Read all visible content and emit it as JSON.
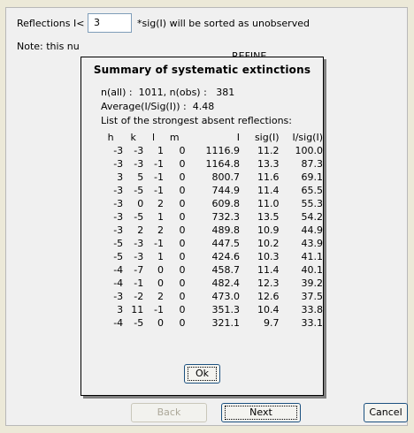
{
  "form": {
    "reflections_label": "Reflections I<",
    "reflections_value": "3",
    "reflections_suffix": "*sig(I) will be sorted as unobserved",
    "note_text": "Note: this nu",
    "note_fragment": "REFINE"
  },
  "summary": {
    "title": "Summary of systematic extinctions",
    "line_counts": "n(all) :  1011, n(obs) :   381",
    "line_average": "Average(I/Sig(I)) :  4.48",
    "line_list": "List of the strongest absent reflections:",
    "columns": [
      "h",
      "k",
      "l",
      "m",
      "I",
      "sig(I)",
      "I/sig(I)"
    ],
    "rows": [
      [
        "-3",
        "-3",
        "1",
        "0",
        "1116.9",
        "11.2",
        "100.0"
      ],
      [
        "-3",
        "-3",
        "-1",
        "0",
        "1164.8",
        "13.3",
        "87.3"
      ],
      [
        "3",
        "5",
        "-1",
        "0",
        "800.7",
        "11.6",
        "69.1"
      ],
      [
        "-3",
        "-5",
        "-1",
        "0",
        "744.9",
        "11.4",
        "65.5"
      ],
      [
        "-3",
        "0",
        "2",
        "0",
        "609.8",
        "11.0",
        "55.3"
      ],
      [
        "-3",
        "-5",
        "1",
        "0",
        "732.3",
        "13.5",
        "54.2"
      ],
      [
        "-3",
        "2",
        "2",
        "0",
        "489.8",
        "10.9",
        "44.9"
      ],
      [
        "-5",
        "-3",
        "-1",
        "0",
        "447.5",
        "10.2",
        "43.9"
      ],
      [
        "-5",
        "-3",
        "1",
        "0",
        "424.6",
        "10.3",
        "41.1"
      ],
      [
        "-4",
        "-7",
        "0",
        "0",
        "458.7",
        "11.4",
        "40.1"
      ],
      [
        "-4",
        "-1",
        "0",
        "0",
        "482.4",
        "12.3",
        "39.2"
      ],
      [
        "-3",
        "-2",
        "2",
        "0",
        "473.0",
        "12.6",
        "37.5"
      ],
      [
        "3",
        "11",
        "-1",
        "0",
        "351.3",
        "10.4",
        "33.8"
      ],
      [
        "-4",
        "-5",
        "0",
        "0",
        "321.1",
        "9.7",
        "33.1"
      ]
    ],
    "ok_label": "Ok"
  },
  "footer": {
    "back_label": "Back",
    "next_label": "Next",
    "cancel_label": "Cancel"
  }
}
